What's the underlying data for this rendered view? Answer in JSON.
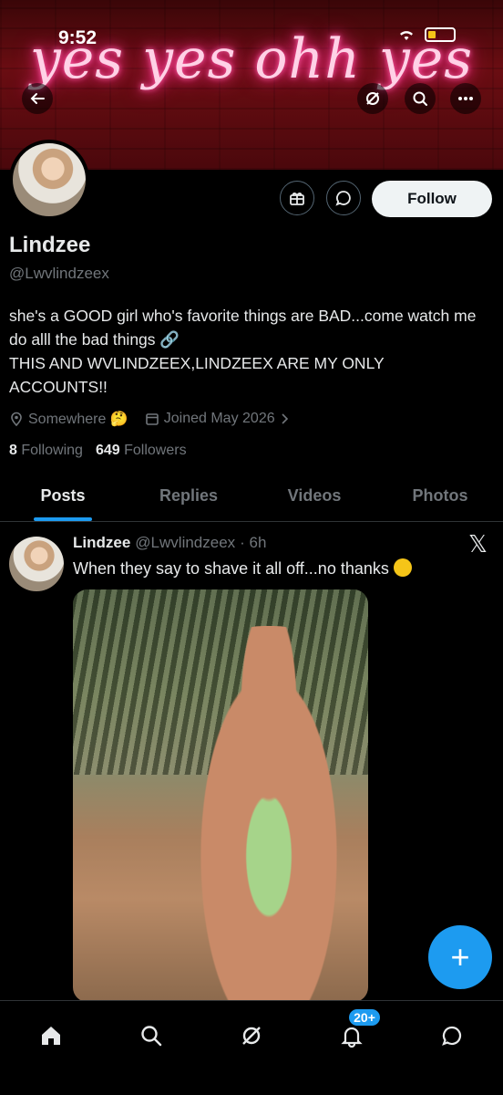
{
  "status": {
    "time": "9:52"
  },
  "banner": {
    "neon_text": "yes yes ohh yes"
  },
  "profile": {
    "display_name": "Lindzee",
    "handle": "@Lwvlindzeex",
    "follow_label": "Follow",
    "bio_line1": "she's a GOOD girl who's favorite things are BAD...come watch me do alll the bad things 🔗",
    "bio_line2": "THIS AND WVLINDZEEX,LINDZEEX ARE MY ONLY ACCOUNTS!!",
    "location": "Somewhere 🤔",
    "joined": "Joined May 2026",
    "following_count": "8",
    "following_label": "Following",
    "followers_count": "649",
    "followers_label": "Followers"
  },
  "tabs": [
    {
      "label": "Posts",
      "active": true
    },
    {
      "label": "Replies",
      "active": false
    },
    {
      "label": "Videos",
      "active": false
    },
    {
      "label": "Photos",
      "active": false
    }
  ],
  "post": {
    "name": "Lindzee",
    "handle": "@Lwvlindzeex",
    "time": "· 6h",
    "text": "When they say to shave it all off...no thanks"
  },
  "fab_label": "+",
  "nav": {
    "notifications_badge": "20+"
  },
  "colors": {
    "accent": "#1d9bf0",
    "background": "#000000",
    "banner": "#6a0d12"
  }
}
